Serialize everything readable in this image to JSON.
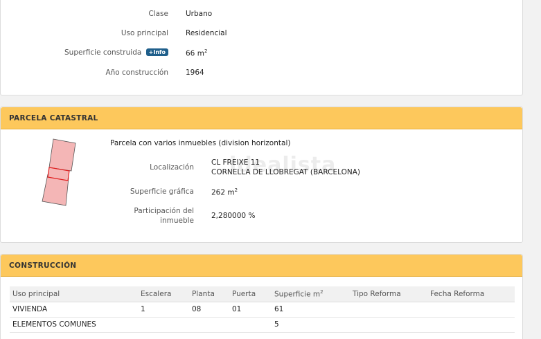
{
  "inmueble": {
    "clase_label": "Clase",
    "clase_value": "Urbano",
    "uso_label": "Uso principal",
    "uso_value": "Residencial",
    "superficie_label": "Superficie construida",
    "info_badge": "+Info",
    "superficie_value": "66 m",
    "superficie_unit_sup": "2",
    "anio_label": "Año construcción",
    "anio_value": "1964"
  },
  "parcela": {
    "title": "PARCELA CATASTRAL",
    "description": "Parcela con varios inmuebles (division horizontal)",
    "localizacion_label": "Localización",
    "localizacion_line1": "CL FREIXE 11",
    "localizacion_line2": "CORNELLA DE LLOBREGAT (BARCELONA)",
    "superficie_label": "Superficie gráfica",
    "superficie_value": "262 m",
    "superficie_unit_sup": "2",
    "participacion_label_line1": "Participación del",
    "participacion_label_line2": "inmueble",
    "participacion_value": "2,280000 %",
    "watermark": "idealista",
    "colors": {
      "parcel_fill": "#f4b6b6",
      "parcel_stroke": "#555555",
      "highlight_stroke": "#e02020"
    }
  },
  "construccion": {
    "title": "CONSTRUCCIÓN",
    "columns": [
      "Uso principal",
      "Escalera",
      "Planta",
      "Puerta",
      "Superficie m",
      "Tipo Reforma",
      "Fecha Reforma"
    ],
    "superficie_col_sup": "2",
    "rows": [
      [
        "VIVIENDA",
        "1",
        "08",
        "01",
        "61",
        "",
        ""
      ],
      [
        "ELEMENTOS COMUNES",
        "",
        "",
        "",
        "5",
        "",
        ""
      ]
    ]
  },
  "colors": {
    "header_bg": "#fdc85c",
    "badge_bg": "#1f5f8b"
  }
}
